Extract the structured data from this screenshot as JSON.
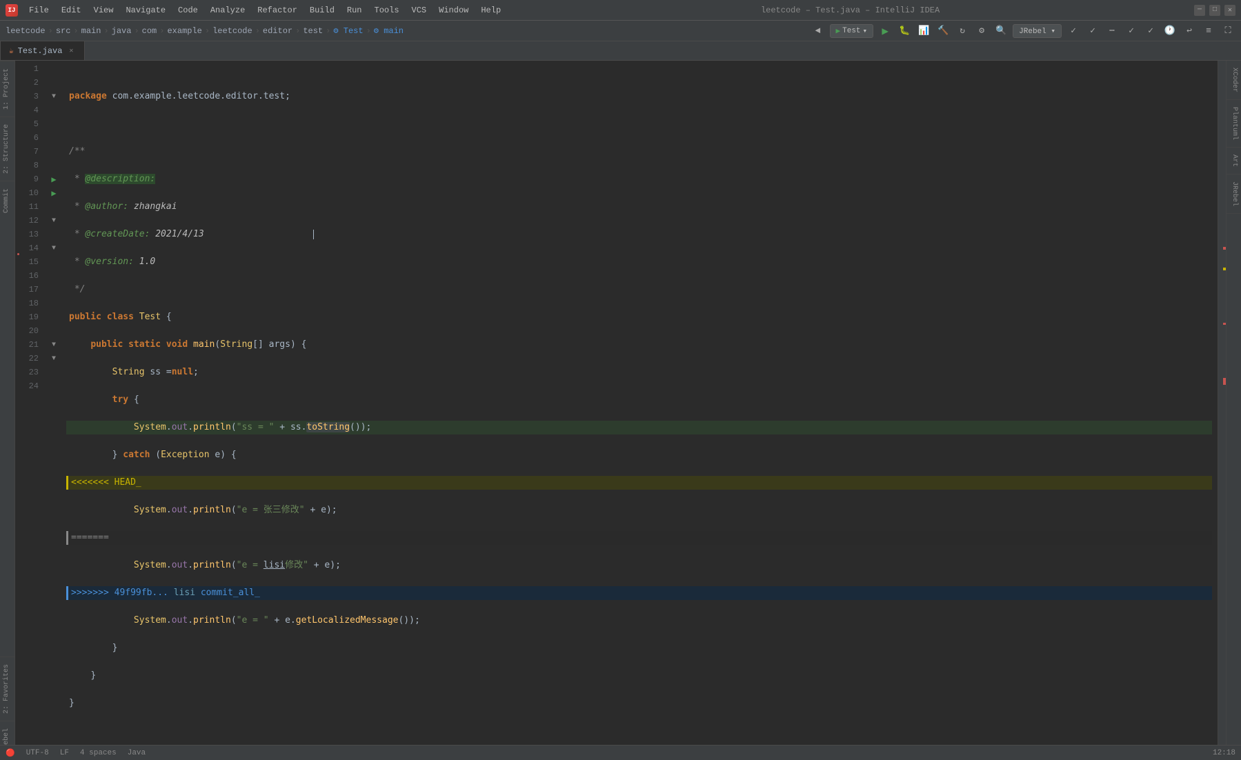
{
  "titleBar": {
    "appIcon": "I",
    "title": "leetcode – Test.java – IntelliJ IDEA",
    "menus": [
      "File",
      "Edit",
      "View",
      "Navigate",
      "Code",
      "Analyze",
      "Refactor",
      "Build",
      "Run",
      "Tools",
      "VCS",
      "Window",
      "Help"
    ],
    "runConfig": "Test"
  },
  "breadcrumb": {
    "items": [
      "leetcode",
      "src",
      "main",
      "java",
      "com",
      "example",
      "leetcode",
      "editor",
      "test",
      "Test",
      "main"
    ]
  },
  "tabs": [
    {
      "label": "Test.java",
      "icon": "☕",
      "active": true
    }
  ],
  "leftPanel": {
    "tabs": [
      {
        "label": "1: Project",
        "active": false
      },
      {
        "label": "2: Structure",
        "active": false
      },
      {
        "label": "Commit",
        "active": false
      }
    ]
  },
  "rightPanel": {
    "tabs": [
      {
        "label": "XCoder",
        "active": false
      },
      {
        "label": "Plantuml",
        "active": false
      },
      {
        "label": "Art",
        "active": false
      },
      {
        "label": "JRebel",
        "active": false
      }
    ]
  },
  "code": {
    "lines": [
      {
        "num": 1,
        "text": "package com.example.leetcode.editor.test;",
        "type": "normal"
      },
      {
        "num": 2,
        "text": "",
        "type": "normal"
      },
      {
        "num": 3,
        "text": "/**",
        "type": "comment",
        "foldable": true
      },
      {
        "num": 4,
        "text": " * @description:",
        "type": "javadoc"
      },
      {
        "num": 5,
        "text": " * @author: zhangkai",
        "type": "javadoc"
      },
      {
        "num": 6,
        "text": " * @createDate: 2021/4/13",
        "type": "javadoc"
      },
      {
        "num": 7,
        "text": " * @version: 1.0",
        "type": "javadoc"
      },
      {
        "num": 8,
        "text": " */",
        "type": "comment"
      },
      {
        "num": 9,
        "text": "public class Test {",
        "type": "class",
        "runnable": true
      },
      {
        "num": 10,
        "text": "    public static void main(String[] args) {",
        "type": "method",
        "runnable": true
      },
      {
        "num": 11,
        "text": "        String ss =null;",
        "type": "normal"
      },
      {
        "num": 12,
        "text": "        try {",
        "type": "normal",
        "foldable": true
      },
      {
        "num": 13,
        "text": "            System.out.println(\"ss = \" + ss.toString());",
        "type": "highlight"
      },
      {
        "num": 14,
        "text": "        } catch (Exception e) {",
        "type": "normal",
        "foldable": true
      },
      {
        "num": 15,
        "text": "<<<<<<< HEAD_",
        "type": "conflict-head"
      },
      {
        "num": 16,
        "text": "            System.out.println(\"e = 张三修改\" + e);",
        "type": "normal"
      },
      {
        "num": 17,
        "text": "=======",
        "type": "conflict-sep"
      },
      {
        "num": 18,
        "text": "            System.out.println(\"e = lisi修改\" + e);",
        "type": "normal"
      },
      {
        "num": 19,
        "text": ">>>>>>> 49f99fb... lisi commit_all_",
        "type": "conflict-end"
      },
      {
        "num": 20,
        "text": "            System.out.println(\"e = \" + e.getLocalizedMessage());",
        "type": "normal"
      },
      {
        "num": 21,
        "text": "        }",
        "type": "normal",
        "foldable": true
      },
      {
        "num": 22,
        "text": "    }",
        "type": "normal",
        "foldable": true
      },
      {
        "num": 23,
        "text": "}",
        "type": "normal"
      },
      {
        "num": 24,
        "text": "",
        "type": "normal"
      }
    ]
  },
  "statusBar": {
    "encoding": "UTF-8",
    "lineEnding": "LF",
    "indent": "4 spaces",
    "language": "Java"
  }
}
